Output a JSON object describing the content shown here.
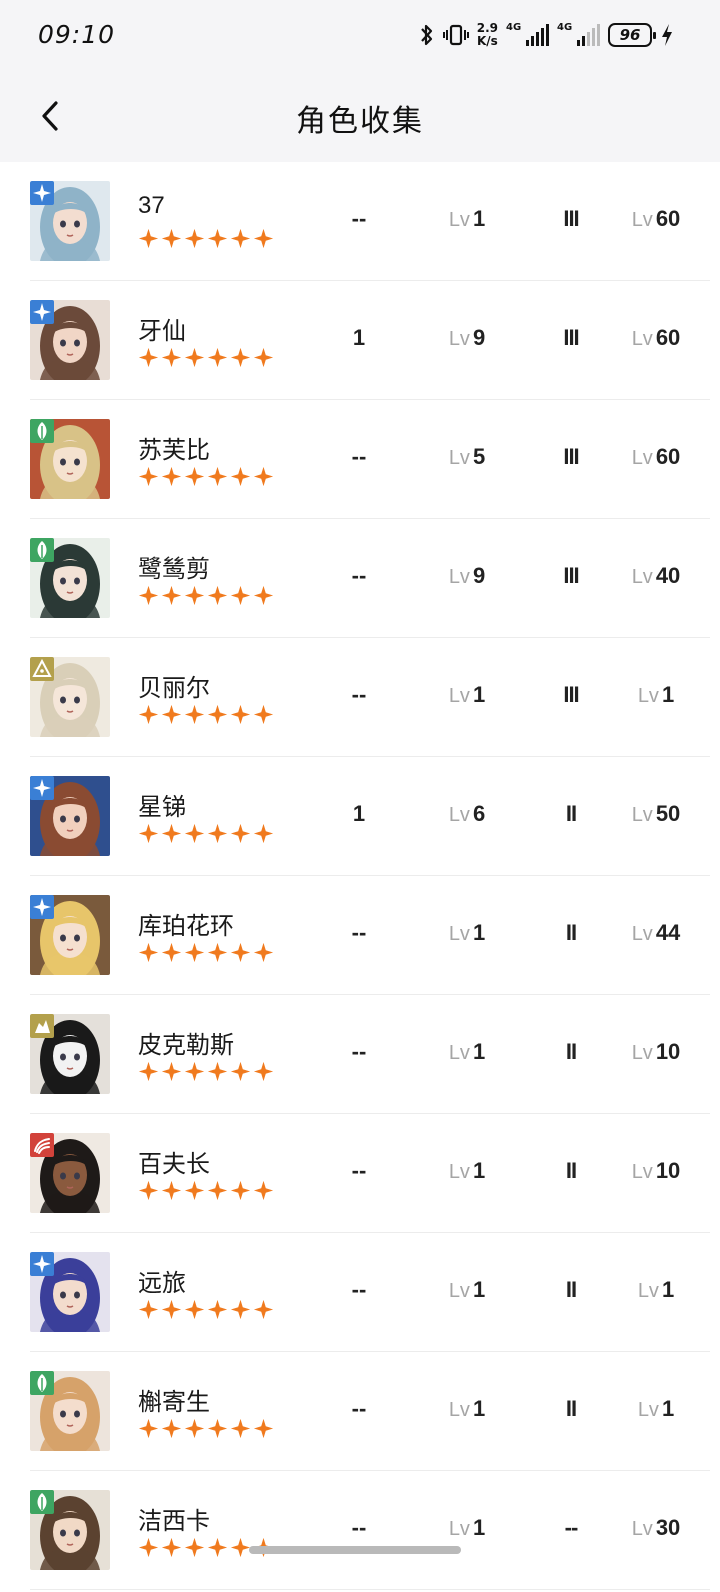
{
  "status_bar": {
    "time": "09:10",
    "net_speed_value": "2.9",
    "net_speed_unit": "K/s",
    "signal1_label": "4G",
    "signal2_label": "4G",
    "battery": "96",
    "icons": [
      "bluetooth-icon",
      "vibrate-icon",
      "signal-icon",
      "signal-icon",
      "battery-icon",
      "charging-icon"
    ]
  },
  "header": {
    "back_icon": "chevron-left-icon",
    "title": "角色收集"
  },
  "colors": {
    "star": "#f07a1e",
    "badge_blue": "#3a7fd5",
    "badge_green": "#3ea562",
    "badge_olive": "#b3a04c",
    "badge_red": "#d2423a",
    "lv_prefix": "#a5a5a5"
  },
  "characters": [
    {
      "name": "37",
      "element": "blue",
      "element_icon": "star-sparkle-icon",
      "stars": 6,
      "c1": "--",
      "lv_a": "1",
      "tier": "III",
      "lv_b": "60",
      "portrait": {
        "hair": "#8fb3c8",
        "skin": "#f3ddd0",
        "bg": "#dfe8ee"
      }
    },
    {
      "name": "牙仙",
      "element": "blue",
      "element_icon": "star-sparkle-icon",
      "stars": 6,
      "c1": "1",
      "lv_a": "9",
      "tier": "III",
      "lv_b": "60",
      "portrait": {
        "hair": "#6b4a3a",
        "skin": "#f1d6c6",
        "bg": "#e8ddd5"
      }
    },
    {
      "name": "苏芙比",
      "element": "green",
      "element_icon": "leaf-icon",
      "stars": 6,
      "c1": "--",
      "lv_a": "5",
      "tier": "III",
      "lv_b": "60",
      "portrait": {
        "hair": "#d8c287",
        "skin": "#f5e2cf",
        "bg": "#b85436"
      }
    },
    {
      "name": "鹭鸶剪",
      "element": "green",
      "element_icon": "leaf-icon",
      "stars": 6,
      "c1": "--",
      "lv_a": "9",
      "tier": "III",
      "lv_b": "40",
      "portrait": {
        "hair": "#2b3a36",
        "skin": "#f3e2d6",
        "bg": "#e9efe9"
      }
    },
    {
      "name": "贝丽尔",
      "element": "olive",
      "element_icon": "crystal-icon",
      "stars": 6,
      "c1": "--",
      "lv_a": "1",
      "tier": "III",
      "lv_b": "1",
      "portrait": {
        "hair": "#d9cfb8",
        "skin": "#f5e6d9",
        "bg": "#efeae0"
      }
    },
    {
      "name": "星锑",
      "element": "blue",
      "element_icon": "star-sparkle-icon",
      "stars": 6,
      "c1": "1",
      "lv_a": "6",
      "tier": "II",
      "lv_b": "50",
      "portrait": {
        "hair": "#8a4b32",
        "skin": "#f1d0bd",
        "bg": "#2f4f8e"
      }
    },
    {
      "name": "库珀花环",
      "element": "blue",
      "element_icon": "star-sparkle-icon",
      "stars": 6,
      "c1": "--",
      "lv_a": "1",
      "tier": "II",
      "lv_b": "44",
      "portrait": {
        "hair": "#e7c56a",
        "skin": "#f5e0cf",
        "bg": "#7a5a3c"
      }
    },
    {
      "name": "皮克勒斯",
      "element": "olive",
      "element_icon": "rock-icon",
      "stars": 6,
      "c1": "--",
      "lv_a": "1",
      "tier": "II",
      "lv_b": "10",
      "portrait": {
        "hair": "#1a1a1a",
        "skin": "#f2f2f2",
        "bg": "#e4e0da"
      }
    },
    {
      "name": "百夫长",
      "element": "red",
      "element_icon": "claw-icon",
      "stars": 6,
      "c1": "--",
      "lv_a": "1",
      "tier": "II",
      "lv_b": "10",
      "portrait": {
        "hair": "#1e1a18",
        "skin": "#8a5a3e",
        "bg": "#efe9e2"
      }
    },
    {
      "name": "远旅",
      "element": "blue",
      "element_icon": "star-sparkle-icon",
      "stars": 6,
      "c1": "--",
      "lv_a": "1",
      "tier": "II",
      "lv_b": "1",
      "portrait": {
        "hair": "#3b3f9a",
        "skin": "#f3dccd",
        "bg": "#e4e2ee"
      }
    },
    {
      "name": "槲寄生",
      "element": "green",
      "element_icon": "leaf-icon",
      "stars": 6,
      "c1": "--",
      "lv_a": "1",
      "tier": "II",
      "lv_b": "1",
      "portrait": {
        "hair": "#d6a26a",
        "skin": "#f4ddcd",
        "bg": "#ede4dc"
      }
    },
    {
      "name": "洁西卡",
      "element": "green",
      "element_icon": "leaf-icon",
      "stars": 6,
      "c1": "--",
      "lv_a": "1",
      "tier": "--",
      "lv_b": "30",
      "portrait": {
        "hair": "#5b4230",
        "skin": "#f1d9c6",
        "bg": "#e6e0d6"
      }
    }
  ],
  "lv_prefix": "Lv"
}
